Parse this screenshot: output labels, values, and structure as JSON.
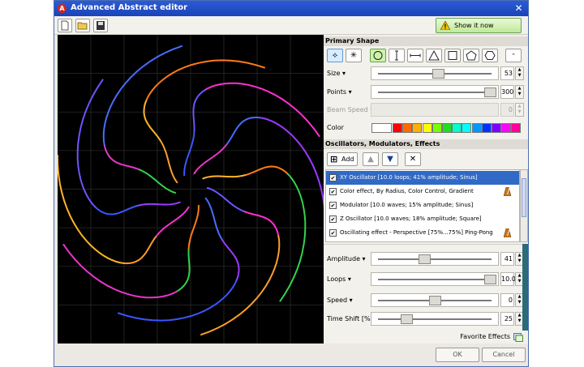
{
  "window": {
    "title": "Advanced Abstract editor",
    "app_icon_glyph": "A"
  },
  "toolbar": {
    "new_icon": "new-document-icon",
    "open_icon": "open-folder-icon",
    "save_icon": "save-disk-icon",
    "show_label": "Show it now"
  },
  "primary_shape": {
    "header": "Primary Shape",
    "shape_icons": [
      "circle-icon",
      "line-vertical-icon",
      "line-horizontal-icon",
      "triangle-icon",
      "square-icon",
      "pentagon-icon",
      "hexagon-icon"
    ],
    "size": {
      "label": "Size",
      "value": "53",
      "level": 0.53
    },
    "points": {
      "label": "Points",
      "value": "300",
      "level": 1.0
    },
    "beam_speed": {
      "label": "Beam Speed",
      "value": "0",
      "disabled": true
    },
    "color": {
      "label": "Color",
      "swatches": [
        "#ffffff",
        "#ff0000",
        "#ff6a00",
        "#ffb000",
        "#ffff00",
        "#7cff00",
        "#22dd22",
        "#00ffcc",
        "#00ffff",
        "#0099ff",
        "#0033ff",
        "#7b00ff",
        "#ff00ff",
        "#ff0099"
      ]
    }
  },
  "effects": {
    "header": "Oscillators, Modulators, Effects",
    "add_label": "Add",
    "items": [
      {
        "checked": true,
        "label": "XY Oscillator [10.0 loops; 41% amplitude; Sinus]",
        "selected": true,
        "metronome": false
      },
      {
        "checked": true,
        "label": "Color effect, By Radius, Color Control, Gradient",
        "selected": false,
        "metronome": true
      },
      {
        "checked": true,
        "label": "Modulator [10.0 waves; 15% amplitude; Sinus]",
        "selected": false,
        "metronome": false
      },
      {
        "checked": true,
        "label": "Z Oscillator [10.0 waves; 18% amplitude; Square]",
        "selected": false,
        "metronome": false
      },
      {
        "checked": true,
        "label": "Oscillating effect - Perspective [75%...75%] Ping-Pong",
        "selected": false,
        "metronome": true
      }
    ]
  },
  "oscillator": {
    "amplitude": {
      "label": "Amplitude",
      "value": "41",
      "level": 0.41
    },
    "loops": {
      "label": "Loops",
      "value": "10.0",
      "level": 1.0
    },
    "speed": {
      "label": "Speed",
      "value": "0",
      "level": 0.5
    },
    "time_shift": {
      "label": "Time Shift [%]",
      "value": "25",
      "level": 0.25
    }
  },
  "favorite_effects_label": "Favorite Effects",
  "buttons": {
    "ok": "OK",
    "cancel": "Cancel"
  }
}
